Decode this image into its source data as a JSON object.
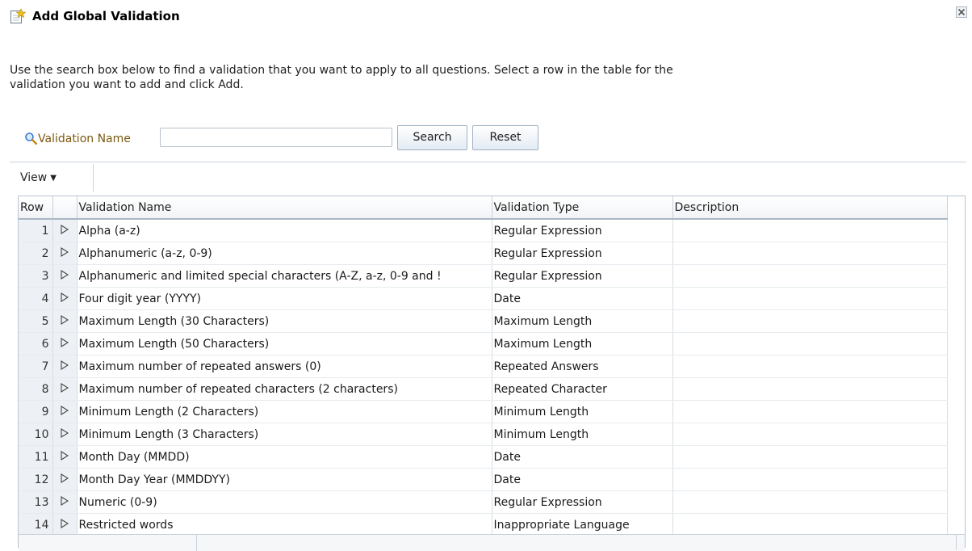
{
  "dialog": {
    "title": "Add Global Validation",
    "title_icon": "new-item-star-icon",
    "close_icon": "close-icon"
  },
  "intro": {
    "text": "Use the search box below to find a validation that you want to apply to all questions. Select a row in the table for the validation you want to add and click Add."
  },
  "search": {
    "icon": "search-icon",
    "label": "Validation Name",
    "value": "",
    "placeholder": "",
    "search_button": "Search",
    "reset_button": "Reset"
  },
  "toolbar": {
    "view_label": "View",
    "view_icon": "chevron-down-icon"
  },
  "table": {
    "columns": [
      "Row",
      "",
      "Validation Name",
      "Validation Type",
      "Description"
    ],
    "rows": [
      {
        "row": "1",
        "name": "Alpha (a-z)",
        "type": "Regular Expression",
        "description": ""
      },
      {
        "row": "2",
        "name": "Alphanumeric (a-z, 0-9)",
        "type": "Regular Expression",
        "description": ""
      },
      {
        "row": "3",
        "name": "Alphanumeric and limited special characters (A-Z, a-z, 0-9 and !",
        "type": "Regular Expression",
        "description": ""
      },
      {
        "row": "4",
        "name": "Four digit year (YYYY)",
        "type": "Date",
        "description": ""
      },
      {
        "row": "5",
        "name": "Maximum Length (30 Characters)",
        "type": "Maximum Length",
        "description": ""
      },
      {
        "row": "6",
        "name": "Maximum Length (50 Characters)",
        "type": "Maximum Length",
        "description": ""
      },
      {
        "row": "7",
        "name": "Maximum number of repeated answers (0)",
        "type": "Repeated Answers",
        "description": ""
      },
      {
        "row": "8",
        "name": "Maximum number of repeated characters (2 characters)",
        "type": "Repeated Character",
        "description": ""
      },
      {
        "row": "9",
        "name": "Minimum Length (2 Characters)",
        "type": "Minimum Length",
        "description": ""
      },
      {
        "row": "10",
        "name": "Minimum Length (3 Characters)",
        "type": "Minimum Length",
        "description": ""
      },
      {
        "row": "11",
        "name": "Month Day (MMDD)",
        "type": "Date",
        "description": ""
      },
      {
        "row": "12",
        "name": "Month Day Year (MMDDYY)",
        "type": "Date",
        "description": ""
      },
      {
        "row": "13",
        "name": "Numeric (0-9)",
        "type": "Regular Expression",
        "description": ""
      },
      {
        "row": "14",
        "name": "Restricted words",
        "type": "Inappropriate Language",
        "description": ""
      }
    ],
    "disclose_icon": "disclosure-triangle-icon"
  },
  "colors": {
    "label_accent": "#7a5a10",
    "header_border": "#aab6c2",
    "row_header_bg": "#edf1f5"
  }
}
